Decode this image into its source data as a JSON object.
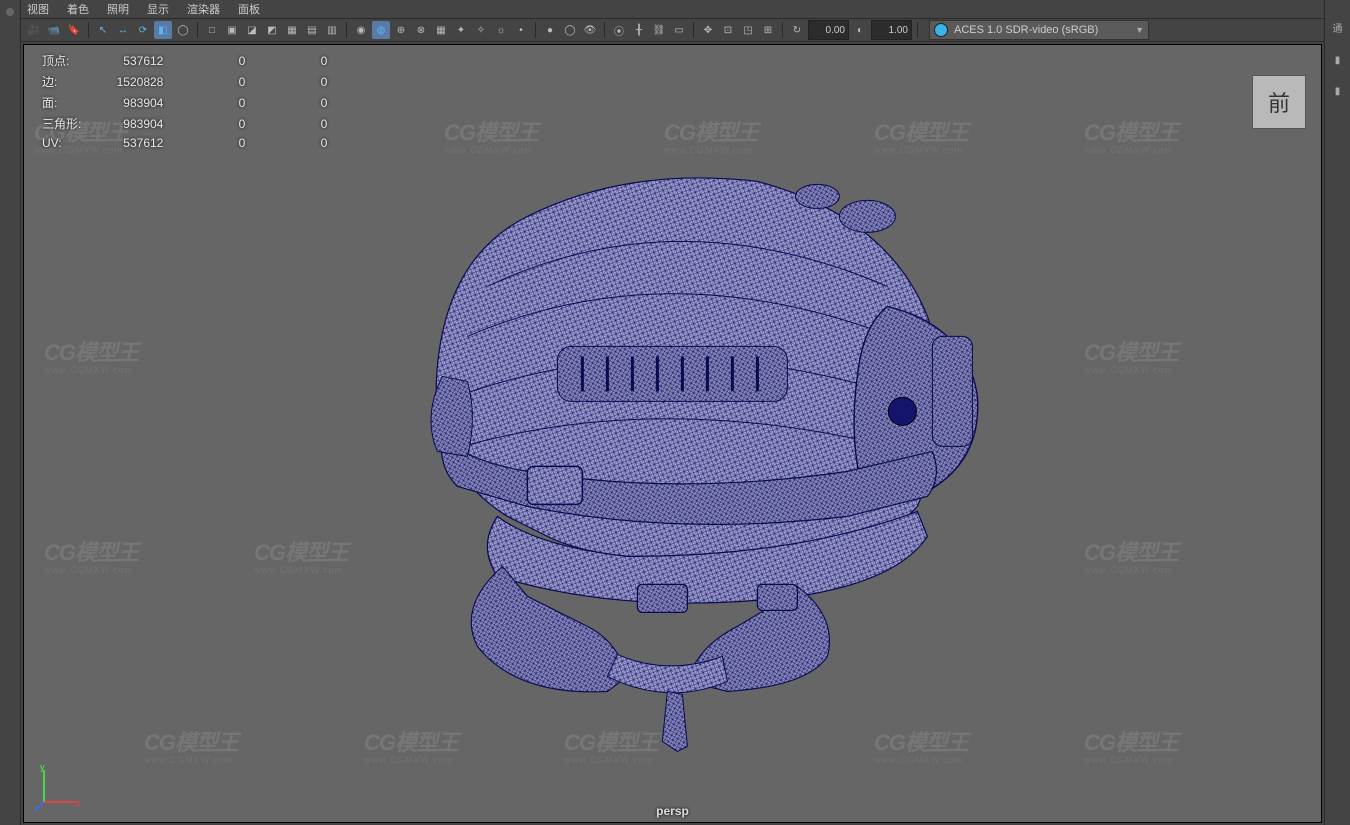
{
  "menus": {
    "view": "视图",
    "shading": "着色",
    "lighting": "照明",
    "show": "显示",
    "renderer": "渲染器",
    "panels": "面板"
  },
  "toolbar": {
    "time_a": "0.00",
    "time_b": "1.00"
  },
  "colorspace": {
    "label": "ACES 1.0 SDR-video (sRGB)"
  },
  "hud": {
    "rows": [
      {
        "label": "顶点:",
        "a": "537612",
        "b": "0",
        "c": "0"
      },
      {
        "label": "边:",
        "a": "1520828",
        "b": "0",
        "c": "0"
      },
      {
        "label": "面:",
        "a": "983904",
        "b": "0",
        "c": "0"
      },
      {
        "label": "三角形:",
        "a": "983904",
        "b": "0",
        "c": "0"
      },
      {
        "label": "UV:",
        "a": "537612",
        "b": "0",
        "c": "0"
      }
    ]
  },
  "camera": "persp",
  "viewcube": "前",
  "watermark": {
    "brand": "CG模型王",
    "url": "www.CGMXW.com"
  },
  "right_panel_hint": "通",
  "icons": {
    "set": [
      "camera",
      "camera2",
      "bookmark",
      "divider",
      "select-arrow",
      "move",
      "rotate",
      "scale",
      "lasso",
      "divider",
      "cube",
      "cube-wire",
      "shade-flat",
      "shade-smooth",
      "light",
      "texture",
      "divider",
      "sphere",
      "sphere-wire",
      "globe",
      "grid",
      "normals",
      "light2",
      "sun",
      "dot",
      "divider",
      "sphere2",
      "circle",
      "eye",
      "divider",
      "joint",
      "ik",
      "link",
      "divider",
      "snap",
      "isolate",
      "xray",
      "divider",
      "gear"
    ]
  }
}
